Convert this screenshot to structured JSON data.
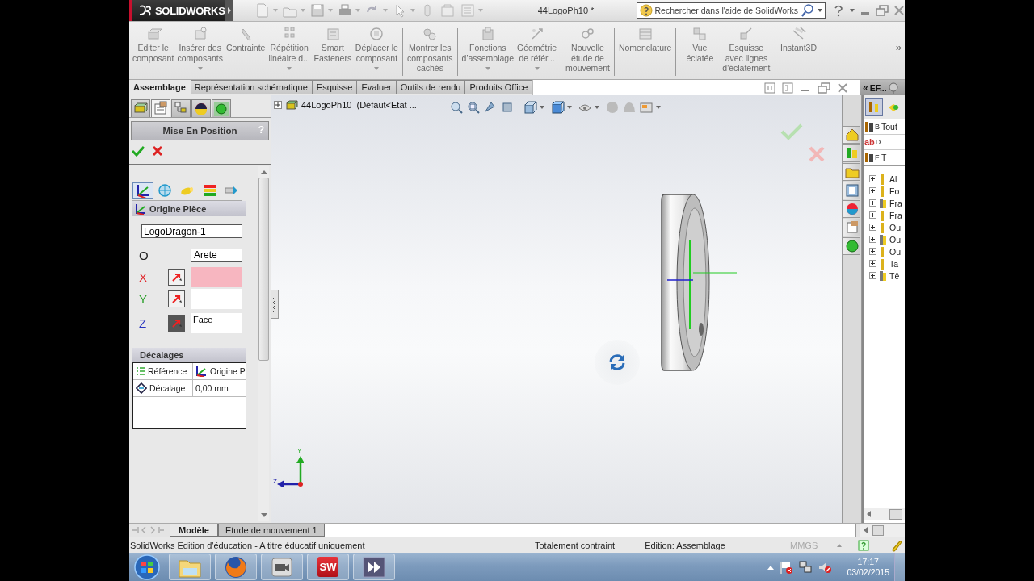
{
  "app": {
    "logo": "SOLIDWORKS"
  },
  "window": {
    "title": "44LogoPh10 *"
  },
  "search": {
    "placeholder": "Rechercher dans l'aide de SolidWorks"
  },
  "command_groups": [
    [
      {
        "label": "Editer le\ncomposant",
        "dropdown": false
      },
      {
        "label": "Insérer des\ncomposants",
        "dropdown": true
      },
      {
        "label": "Contrainte",
        "dropdown": false
      },
      {
        "label": "Répétition\nlinéaire d...",
        "dropdown": true
      },
      {
        "label": "Smart\nFasteners",
        "dropdown": false
      },
      {
        "label": "Déplacer le\ncomposant",
        "dropdown": true
      }
    ],
    [
      {
        "label": "Montrer les\ncomposants\ncachés",
        "dropdown": false
      }
    ],
    [
      {
        "label": "Fonctions\nd'assemblage",
        "dropdown": true
      },
      {
        "label": "Géométrie\nde référ...",
        "dropdown": true
      }
    ],
    [
      {
        "label": "Nouvelle\nétude de\nmouvement",
        "dropdown": false
      }
    ],
    [
      {
        "label": "Nomenclature",
        "dropdown": false
      }
    ],
    [
      {
        "label": "Vue\néclatée",
        "dropdown": false
      },
      {
        "label": "Esquisse\navec lignes\nd'éclatement",
        "dropdown": false
      }
    ],
    [
      {
        "label": "Instant3D",
        "dropdown": false
      }
    ]
  ],
  "overflow": "»",
  "ribbon_tabs": [
    {
      "label": "Assemblage",
      "selected": true
    },
    {
      "label": "Représentation schématique",
      "selected": false
    },
    {
      "label": "Esquisse",
      "selected": false
    },
    {
      "label": "Evaluer",
      "selected": false
    },
    {
      "label": "Outils de rendu",
      "selected": false
    },
    {
      "label": "Produits Office",
      "selected": false
    }
  ],
  "property_manager": {
    "tabs": [
      {
        "selected": false
      },
      {
        "selected": true
      },
      {
        "selected": false
      },
      {
        "selected": false
      },
      {
        "selected": false
      }
    ],
    "title": "Mise En Position",
    "help": "?",
    "select_modes": [
      {
        "selected": true
      },
      {
        "selected": false
      },
      {
        "selected": false
      },
      {
        "selected": false
      },
      {
        "selected": false
      }
    ],
    "section_title": "Origine Pièce",
    "component": "LogoDragon-1",
    "references": [
      {
        "kind": "origin",
        "axis": "O",
        "value": "Arete"
      },
      {
        "kind": "axis",
        "axis": "X",
        "color": "#e0282c",
        "highlighted": true,
        "active": false
      },
      {
        "kind": "axis",
        "axis": "Y",
        "color": "#2ca02c",
        "highlighted": false,
        "active": false
      },
      {
        "kind": "axis",
        "axis": "Z",
        "color": "#2834c0",
        "value": "Face",
        "highlighted": false,
        "active": true
      }
    ],
    "offsets": {
      "title": "Décalages",
      "rows": [
        {
          "label": "Référence",
          "value": "Origine P"
        },
        {
          "label": "Décalage",
          "value": "0,00 mm"
        }
      ]
    }
  },
  "viewport": {
    "tree_root": "44LogoPh10  (Défaut<Etat ...",
    "triad": {
      "y": "Y",
      "z": "Z"
    }
  },
  "design_library": {
    "collapse": "«",
    "title": "EF...",
    "tabs": [
      {
        "selected": true
      },
      {
        "selected": false
      }
    ],
    "filters": [
      {
        "kind": "tool",
        "label": "B",
        "value": "Tout"
      },
      {
        "kind": "text",
        "badge": "ab",
        "label": "D"
      },
      {
        "kind": "tool",
        "label": "F",
        "value": "T"
      }
    ],
    "items": [
      "Al",
      "Fo",
      "Fra",
      "Fra",
      "Ou",
      "Ou",
      "Ou",
      "Ta",
      "Tê"
    ]
  },
  "bottom_tabs": [
    {
      "label": "Modèle",
      "selected": true
    },
    {
      "label": "Etude de mouvement 1",
      "selected": false
    }
  ],
  "status_bar": {
    "message": "SolidWorks Edition d'éducation - A titre éducatif uniquement",
    "constraint": "Totalement contraint",
    "mode": "Edition: Assemblage",
    "units": "MMGS"
  },
  "taskbar": {
    "apps": [
      {
        "kind": "folder"
      },
      {
        "kind": "firefox"
      },
      {
        "kind": "video"
      },
      {
        "kind": "solidworks",
        "label": "SW"
      },
      {
        "kind": "media"
      }
    ],
    "time": "17:17",
    "date": "03/02/2015"
  }
}
